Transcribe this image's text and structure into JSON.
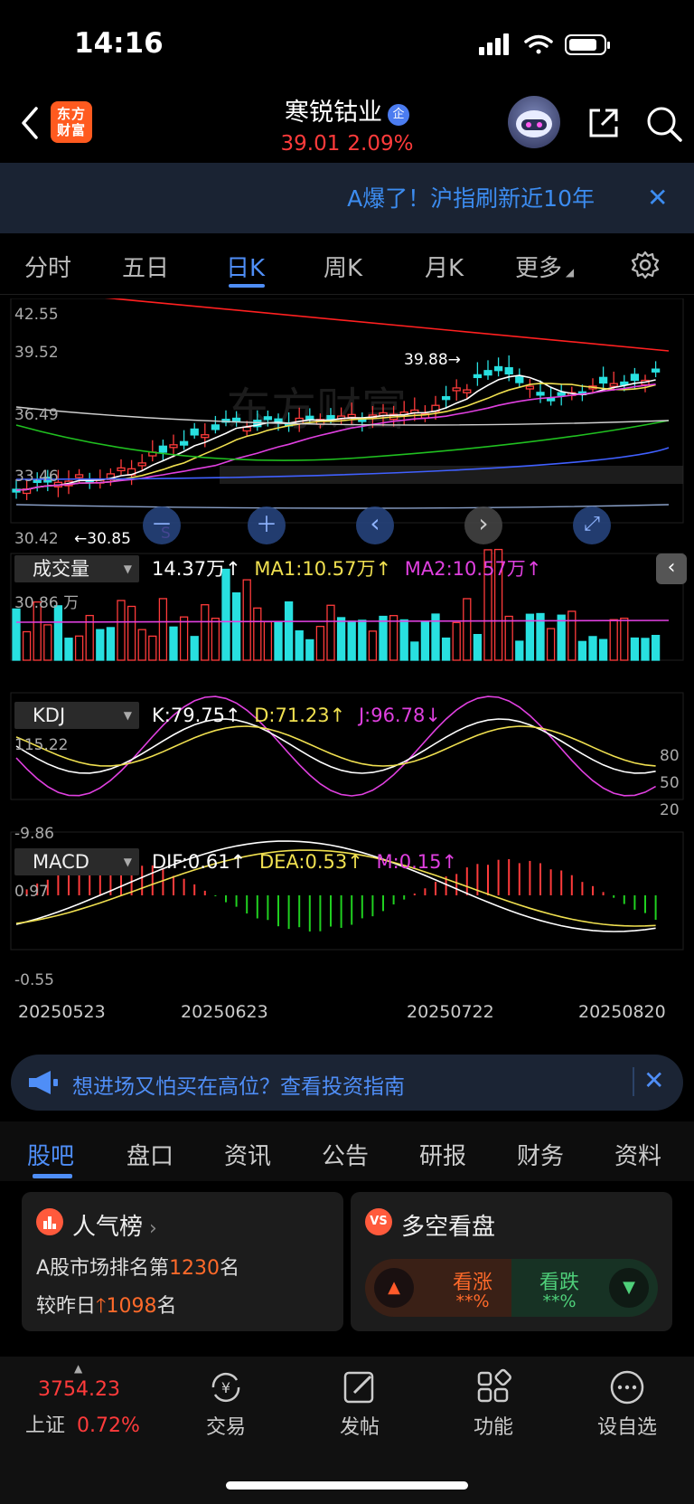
{
  "status": {
    "time": "14:16"
  },
  "header": {
    "logo_line1": "东方",
    "logo_line2": "财富",
    "stock_name": "寒锐钴业",
    "verified_badge": "企",
    "price": "39.01",
    "change_pct": "2.09%"
  },
  "banner": {
    "text": "A爆了！沪指刷新近10年",
    "close": "✕"
  },
  "tabs": [
    "分时",
    "五日",
    "日K",
    "周K",
    "月K",
    "更多"
  ],
  "active_tab": "日K",
  "kline": {
    "y_labels": [
      "42.55",
      "39.52",
      "36.49",
      "33.46",
      "30.42"
    ],
    "high_marker": "39.88",
    "low_marker": "30.85",
    "watermark": "东方财富",
    "toolbar": [
      "－",
      "＋",
      "‹",
      "›",
      "⤢"
    ],
    "s_marker": "S",
    "colors": {
      "up": "#ff3b3b",
      "down": "#28e0e0",
      "ma5": "#ffffff",
      "ma10": "#f0e050",
      "ma20": "#e040e0",
      "ma60": "#20c020",
      "ma120": "#4060ff",
      "ma250": "#ff2020"
    }
  },
  "volume": {
    "selector": "成交量",
    "value": "14.37万",
    "ma1": "MA1:10.57万",
    "ma2": "MA2:10.57万",
    "axis_top": "30.86 万",
    "arrow": "↑"
  },
  "kdj": {
    "selector": "KDJ",
    "k": "K:79.75",
    "d": "D:71.23",
    "j": "J:96.78",
    "k_arrow": "↑",
    "d_arrow": "↑",
    "j_arrow": "↓",
    "axis_top": "115.22",
    "axis_bottom": "-9.86",
    "levels": [
      "80",
      "50",
      "20"
    ]
  },
  "macd": {
    "selector": "MACD",
    "dif": "DIF:0.61",
    "dea": "DEA:0.53",
    "m": "M:0.15",
    "arrow": "↑",
    "axis_top": "0.97",
    "axis_bottom": "-0.55"
  },
  "dates": [
    "20250523",
    "20250623",
    "20250722",
    "20250820"
  ],
  "hint": {
    "text": "想进场又怕买在高位？查看投资指南",
    "close": "✕"
  },
  "content_tabs": [
    "股吧",
    "盘口",
    "资讯",
    "公告",
    "研报",
    "财务",
    "资料"
  ],
  "cards": {
    "popularity": {
      "title": "人气榜",
      "line1_prefix": "A股市场排名第",
      "rank": "1230",
      "line1_suffix": "名",
      "line2_prefix": "较昨日",
      "change": "1098",
      "line2_suffix": "名"
    },
    "sentiment": {
      "title": "多空看盘",
      "up_label": "看涨",
      "up_value": "**%",
      "down_label": "看跌",
      "down_value": "**%"
    }
  },
  "bottom_nav": {
    "index_value": "3754.23",
    "index_name": "上证",
    "index_change": "0.72%",
    "items": [
      "交易",
      "发帖",
      "功能",
      "设自选"
    ]
  }
}
